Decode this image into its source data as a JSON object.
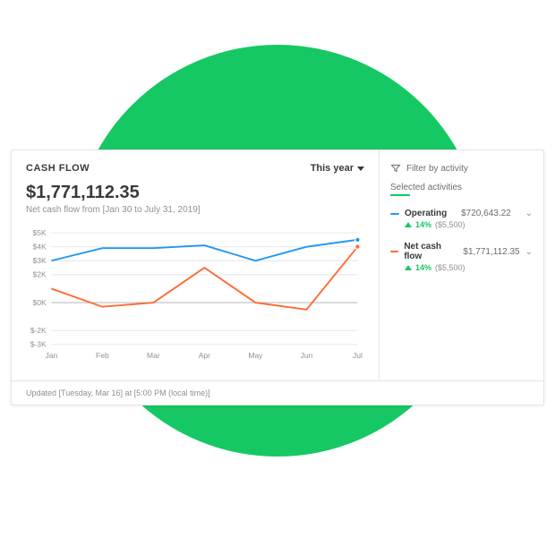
{
  "header": {
    "title": "CASH FLOW",
    "range_label": "This year"
  },
  "summary": {
    "amount": "$1,771,112.35",
    "subtitle": "Net cash flow from [Jan 30 to July 31, 2019]"
  },
  "side": {
    "filter_label": "Filter by activity",
    "selected_label": "Selected activities",
    "items": [
      {
        "name": "Operating",
        "value": "$720,643.22",
        "pct": "14%",
        "delta": "($5,500)",
        "color": "#2196f3"
      },
      {
        "name": "Net cash flow",
        "value": "$1,771,112.35",
        "pct": "14%",
        "delta": "($5,500)",
        "color": "#ff6b35"
      }
    ]
  },
  "footer": {
    "updated": "Updated [Tuesday, Mar 16] at [5:00 PM (local time)]"
  },
  "chart_data": {
    "type": "line",
    "categories": [
      "Jan",
      "Feb",
      "Mar",
      "Apr",
      "May",
      "Jun",
      "Jul"
    ],
    "y_ticks": [
      5,
      4,
      3,
      2,
      0,
      -2,
      -3
    ],
    "ylim": [
      -3,
      5
    ],
    "series": [
      {
        "name": "Operating",
        "color": "#2196f3",
        "values": [
          3.0,
          3.9,
          3.9,
          4.1,
          3.0,
          4.0,
          4.5
        ]
      },
      {
        "name": "Net cash flow",
        "color": "#ff6b35",
        "values": [
          1.0,
          -0.3,
          0.0,
          2.5,
          0.0,
          -0.5,
          4.0
        ]
      }
    ]
  }
}
